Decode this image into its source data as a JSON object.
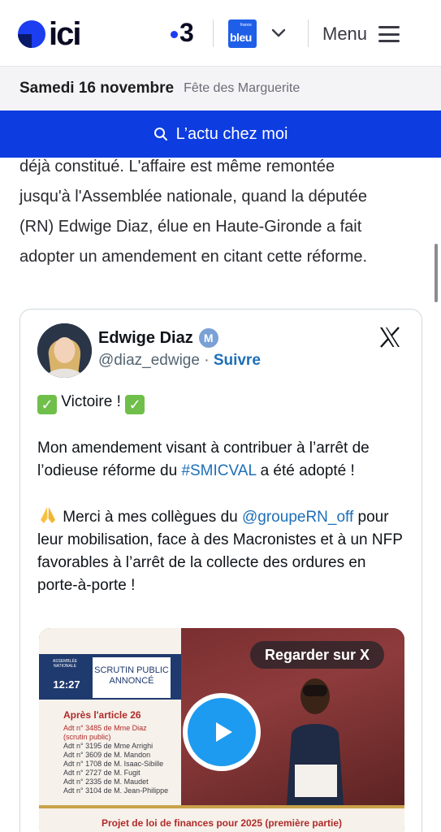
{
  "header": {
    "logo_text": "ici",
    "france3": "3",
    "bleu_label": "bleu",
    "bleu_small": "france",
    "menu_label": "Menu"
  },
  "datebar": {
    "date": "Samedi 16 novembre",
    "feast": "Fête des Marguerite"
  },
  "local_button": {
    "label": "L’actu chez moi"
  },
  "article": {
    "lines": [
      "déjà constitué. L'affaire est même remontée",
      "jusqu'à l'Assemblée nationale, quand la députée",
      "(RN) Edwige Diaz, élue en Haute-Gironde a fait",
      "adopter un amendement en citant cette réforme."
    ]
  },
  "tweet": {
    "author_name": "Edwige Diaz",
    "verified_letter": "M",
    "handle": "@diaz_edwige",
    "separator": " · ",
    "follow_label": "Suivre",
    "line1": "Victoire !",
    "para2_before": "Mon amendement visant à contribuer à l’arrêt de l’odieuse réforme du ",
    "para2_hashtag": "#SMICVAL",
    "para2_after": " a été adopté !",
    "para3_before": " Merci à mes collègues du ",
    "para3_mention": "@groupeRN_off",
    "para3_after": " pour leur mobilisation, face à des Macronistes et à un NFP favorables à l’arrêt de la collecte des ordures en porte-à-porte !",
    "video": {
      "watch_label": "Regarder sur X",
      "assembly_label": "ASSEMBLÉE NATIONALE",
      "time": "12:27",
      "scrutin": "SCRUTIN PUBLIC ANNONCÉ",
      "after_article": "Après l'article 26",
      "amendments": [
        "Adt n° 3485 de Mme Diaz",
        "(scrutin public)",
        "Adt n° 3195 de Mme Arrighi",
        "Adt n° 3609 de M. Mandon",
        "Adt n° 1708 de M. Isaac-Sibille",
        "Adt n° 2727 de M. Fugit",
        "Adt n° 2335 de M. Maudet",
        "Adt n° 3104 de M. Jean-Philippe"
      ],
      "bottom_title": "Projet de loi de finances pour 2025 (première partie)"
    }
  },
  "colors": {
    "brand_blue": "#0d3ce0",
    "link_blue": "#1d6fb8",
    "play_blue": "#1d9bf0"
  },
  "icons": [
    "search-icon",
    "chevron-down-icon",
    "hamburger-icon",
    "verified-badge-icon",
    "x-logo-icon",
    "play-icon",
    "check-mark-emoji",
    "praying-hands-emoji"
  ]
}
